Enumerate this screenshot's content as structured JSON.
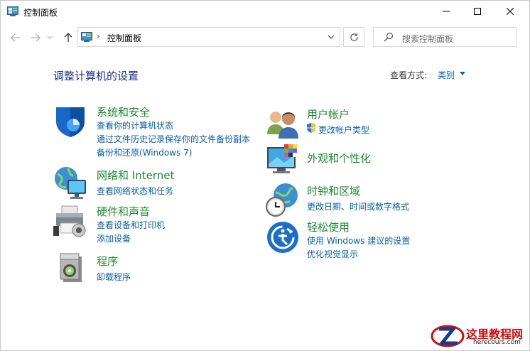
{
  "window": {
    "title": "控制面板"
  },
  "address": {
    "separator": "›",
    "path": "控制面板"
  },
  "search": {
    "placeholder": "搜索控制面板"
  },
  "main": {
    "heading": "调整计算机的设置",
    "view_by_label": "查看方式:",
    "view_by_value": "类别"
  },
  "categories": {
    "system": {
      "title": "系统和安全",
      "links": [
        "查看你的计算机状态",
        "通过文件历史记录保存你的文件备份副本",
        "备份和还原(Windows 7)"
      ]
    },
    "network": {
      "title": "网络和 Internet",
      "links": [
        "查看网络状态和任务"
      ]
    },
    "hardware": {
      "title": "硬件和声音",
      "links": [
        "查看设备和打印机",
        "添加设备"
      ]
    },
    "programs": {
      "title": "程序",
      "links": [
        "卸载程序"
      ]
    },
    "users": {
      "title": "用户帐户",
      "links": [
        "更改帐户类型"
      ]
    },
    "appearance": {
      "title": "外观和个性化",
      "links": []
    },
    "clock": {
      "title": "时钟和区域",
      "links": [
        "更改日期、时间或数字格式"
      ]
    },
    "ease": {
      "title": "轻松使用",
      "links": [
        "使用 Windows 建议的设置",
        "优化视觉显示"
      ]
    }
  },
  "watermark": {
    "title": "这里教程网",
    "url": "herecours.com"
  },
  "colors": {
    "heading": "#1e3287",
    "category": "#1b8a2e",
    "link": "#0b5fa5"
  }
}
